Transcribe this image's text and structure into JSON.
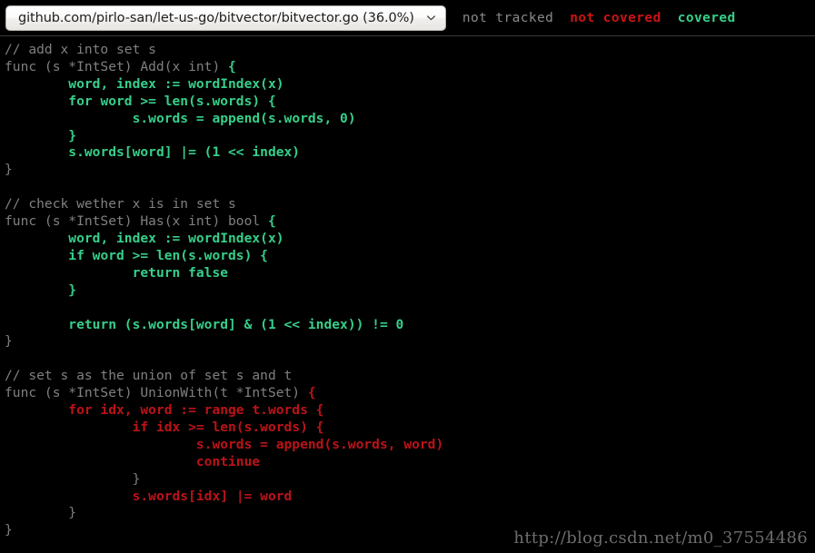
{
  "header": {
    "file_select": {
      "value": "github.com/pirlo-san/let-us-go/bitvector/bitvector.go (36.0%)",
      "chevron_icon": "chevron-down-icon"
    },
    "legend": {
      "not_tracked": "not tracked",
      "not_covered": "not covered",
      "covered": "covered"
    }
  },
  "colors": {
    "background": "#000000",
    "not_tracked": "#808080",
    "not_covered": "#bb1318",
    "covered": "#36cf8a",
    "legend_not_tracked": "#8a8a8a",
    "legend_not_covered": "#cc1414",
    "legend_covered": "#36cf8a",
    "watermark": "#6d6d6d",
    "header_divider": "#3a3a3a"
  },
  "code": {
    "language": "go",
    "tab_size": 8,
    "lines": [
      {
        "segments": [
          {
            "text": "// add x into set s",
            "cov": "untracked"
          }
        ]
      },
      {
        "segments": [
          {
            "text": "func (s *IntSet) Add(x int) ",
            "cov": "untracked"
          },
          {
            "text": "{",
            "cov": "covered"
          }
        ]
      },
      {
        "segments": [
          {
            "text": "\tword, index := wordIndex(x)",
            "cov": "covered"
          }
        ]
      },
      {
        "segments": [
          {
            "text": "\tfor word >= len(s.words) {",
            "cov": "covered"
          }
        ]
      },
      {
        "segments": [
          {
            "text": "\t\ts.words = append(s.words, 0)",
            "cov": "covered"
          }
        ]
      },
      {
        "segments": [
          {
            "text": "\t}",
            "cov": "covered"
          }
        ]
      },
      {
        "segments": [
          {
            "text": "\ts.words[word] |= (1 << index)",
            "cov": "covered"
          }
        ]
      },
      {
        "segments": [
          {
            "text": "}",
            "cov": "untracked"
          }
        ]
      },
      {
        "segments": [
          {
            "text": "",
            "cov": "untracked"
          }
        ]
      },
      {
        "segments": [
          {
            "text": "// check wether x is in set s",
            "cov": "untracked"
          }
        ]
      },
      {
        "segments": [
          {
            "text": "func (s *IntSet) Has(x int) bool ",
            "cov": "untracked"
          },
          {
            "text": "{",
            "cov": "covered"
          }
        ]
      },
      {
        "segments": [
          {
            "text": "\tword, index := wordIndex(x)",
            "cov": "covered"
          }
        ]
      },
      {
        "segments": [
          {
            "text": "\tif word >= len(s.words) {",
            "cov": "covered"
          }
        ]
      },
      {
        "segments": [
          {
            "text": "\t\treturn false",
            "cov": "covered"
          }
        ]
      },
      {
        "segments": [
          {
            "text": "\t}",
            "cov": "covered"
          }
        ]
      },
      {
        "segments": [
          {
            "text": "",
            "cov": "untracked"
          }
        ]
      },
      {
        "segments": [
          {
            "text": "\treturn (s.words[word] & (1 << index)) != 0",
            "cov": "covered"
          }
        ]
      },
      {
        "segments": [
          {
            "text": "}",
            "cov": "untracked"
          }
        ]
      },
      {
        "segments": [
          {
            "text": "",
            "cov": "untracked"
          }
        ]
      },
      {
        "segments": [
          {
            "text": "// set s as the union of set s and t",
            "cov": "untracked"
          }
        ]
      },
      {
        "segments": [
          {
            "text": "func (s *IntSet) UnionWith(t *IntSet) ",
            "cov": "untracked"
          },
          {
            "text": "{",
            "cov": "uncovered"
          }
        ]
      },
      {
        "segments": [
          {
            "text": "\tfor idx, word := range t.words {",
            "cov": "uncovered"
          }
        ]
      },
      {
        "segments": [
          {
            "text": "\t\tif idx >= len(s.words) {",
            "cov": "uncovered"
          }
        ]
      },
      {
        "segments": [
          {
            "text": "\t\t\ts.words = append(s.words, word)",
            "cov": "uncovered"
          }
        ]
      },
      {
        "segments": [
          {
            "text": "\t\t\tcontinue",
            "cov": "uncovered"
          }
        ]
      },
      {
        "segments": [
          {
            "text": "\t\t}",
            "cov": "untracked"
          }
        ]
      },
      {
        "segments": [
          {
            "text": "\t\ts.words[idx] |= word",
            "cov": "uncovered"
          }
        ]
      },
      {
        "segments": [
          {
            "text": "\t}",
            "cov": "untracked"
          }
        ]
      },
      {
        "segments": [
          {
            "text": "}",
            "cov": "untracked"
          }
        ]
      }
    ]
  },
  "watermark": "http://blog.csdn.net/m0_37554486"
}
